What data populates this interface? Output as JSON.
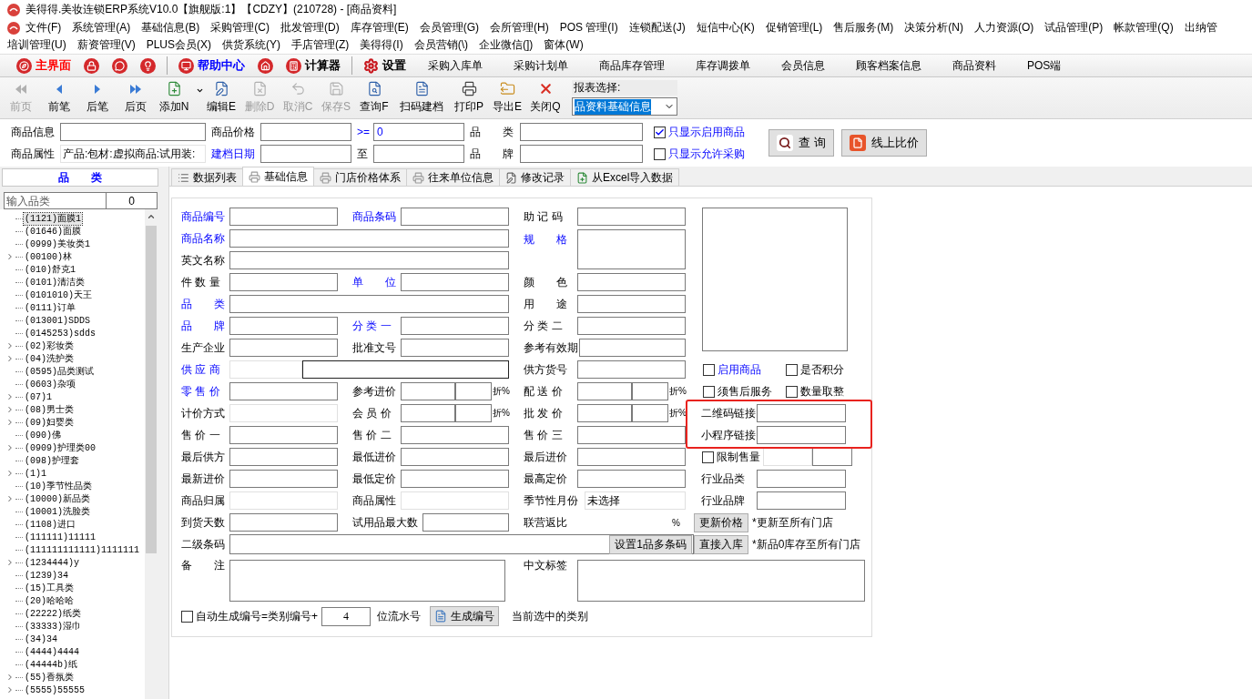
{
  "window": {
    "title": "美得得.美妆连锁ERP系统V10.0【旗舰版:1】【CDZY】(210728) - [商品资料]"
  },
  "menu_bar": {
    "rows": [
      [
        "文件(F)",
        "系统管理(A)",
        "基础信息(B)",
        "采购管理(C)",
        "批发管理(D)",
        "库存管理(E)",
        "会员管理(G)",
        "会所管理(H)",
        "POS 管理(I)",
        "连锁配送(J)",
        "短信中心(K)",
        "促销管理(L)",
        "售后服务(M)",
        "决策分析(N)",
        "人力资源(O)",
        "试品管理(P)",
        "帐款管理(Q)",
        "出纳管"
      ],
      [
        "培训管理(U)",
        "薪资管理(V)",
        "PLUS会员(X)",
        "供货系统(Y)",
        "手店管理(Z)",
        "美得得(I)",
        "会员营销(\\)",
        "企业微信(])",
        "窗体(W)"
      ]
    ]
  },
  "quick_bar": [
    {
      "kind": "compass",
      "label": "主界面",
      "color": "#ff0000"
    },
    {
      "kind": "lock"
    },
    {
      "kind": "chat"
    },
    {
      "kind": "bulb"
    },
    {
      "kind": "separator"
    },
    {
      "kind": "monitor",
      "label": "帮助中心",
      "color": "#0000ff"
    },
    {
      "kind": "home"
    },
    {
      "kind": "calculator",
      "label": "计算器"
    },
    {
      "kind": "separator"
    },
    {
      "kind": "gear",
      "label": "设置"
    }
  ],
  "shortcuts": [
    "采购入库单",
    "采购计划单",
    "商品库存管理",
    "库存调拨单",
    "会员信息",
    "顾客档案信息",
    "商品资料",
    "POS端"
  ],
  "toolbar": [
    {
      "kind": "first",
      "label": "前页",
      "disabled": true
    },
    {
      "kind": "prev",
      "label": "前笔",
      "disabled": false
    },
    {
      "kind": "next",
      "label": "后笔",
      "disabled": false
    },
    {
      "kind": "last",
      "label": "后页",
      "disabled": false
    },
    {
      "kind": "add",
      "label": "添加N",
      "disabled": false,
      "dropdown": true
    },
    {
      "kind": "edit",
      "label": "编辑E",
      "disabled": false
    },
    {
      "kind": "delete",
      "label": "删除D",
      "disabled": true
    },
    {
      "kind": "cancel",
      "label": "取消C",
      "disabled": true
    },
    {
      "kind": "save",
      "label": "保存S",
      "disabled": true
    },
    {
      "kind": "query",
      "label": "查询F",
      "disabled": false
    },
    {
      "kind": "scan",
      "label": "扫码建档",
      "disabled": false
    },
    {
      "kind": "print",
      "label": "打印P",
      "disabled": false
    },
    {
      "kind": "export",
      "label": "导出E",
      "disabled": false
    },
    {
      "kind": "close",
      "label": "关闭Q",
      "disabled": false
    }
  ],
  "report_select": {
    "label": "报表选择:",
    "value": "品资料基础信息"
  },
  "filter": {
    "product_info": {
      "label": "商品信息"
    },
    "price": {
      "label": "商品价格",
      "operator": ">=",
      "value": "0"
    },
    "category": {
      "label": "品　　类"
    },
    "only_enabled": {
      "label": "只显示启用商品",
      "checked": true
    },
    "attributes": {
      "label": "商品属性",
      "value": "产品:包材:虚拟商品:试用装:"
    },
    "created_date": {
      "label": "建档日期",
      "to_label": "至"
    },
    "brand": {
      "label": "品　　牌"
    },
    "only_purchasable": {
      "label": "只显示允许采购",
      "checked": false
    },
    "buttons": [
      {
        "kind": "search",
        "label": "查 询"
      },
      {
        "kind": "compare",
        "label": "线上比价"
      }
    ]
  },
  "category_panel": {
    "title": "品　　类",
    "search": {
      "placeholder": "输入品类"
    },
    "count": "0",
    "items": [
      {
        "label": "(1121)面膜1",
        "expandable": false,
        "selected": true
      },
      {
        "label": "(01646)面膜",
        "expandable": false,
        "selected": false
      },
      {
        "label": "(0999)美妆类1",
        "expandable": false,
        "selected": false
      },
      {
        "label": "(00100)林",
        "expandable": true,
        "selected": false
      },
      {
        "label": "(010)舒克1",
        "expandable": false,
        "selected": false
      },
      {
        "label": "(0101)清洁类",
        "expandable": false,
        "selected": false
      },
      {
        "label": "(0101010)天王",
        "expandable": false,
        "selected": false
      },
      {
        "label": "(0111)订单",
        "expandable": false,
        "selected": false
      },
      {
        "label": "(013001)SDDS",
        "expandable": false,
        "selected": false
      },
      {
        "label": "(0145253)sdds",
        "expandable": false,
        "selected": false
      },
      {
        "label": "(02)彩妆类",
        "expandable": true,
        "selected": false
      },
      {
        "label": "(04)洗护类",
        "expandable": true,
        "selected": false
      },
      {
        "label": "(0595)品类测试",
        "expandable": false,
        "selected": false
      },
      {
        "label": "(0603)杂项",
        "expandable": false,
        "selected": false
      },
      {
        "label": "(07)1",
        "expandable": true,
        "selected": false
      },
      {
        "label": "(08)男士类",
        "expandable": true,
        "selected": false
      },
      {
        "label": "(09)妇婴类",
        "expandable": true,
        "selected": false
      },
      {
        "label": "(090)佛",
        "expandable": false,
        "selected": false
      },
      {
        "label": "(0909)护理类00",
        "expandable": true,
        "selected": false
      },
      {
        "label": "(098)护理套",
        "expandable": false,
        "selected": false
      },
      {
        "label": "(1)1",
        "expandable": true,
        "selected": false
      },
      {
        "label": "(10)季节性品类",
        "expandable": false,
        "selected": false
      },
      {
        "label": "(10000)新品类",
        "expandable": true,
        "selected": false
      },
      {
        "label": "(10001)洗脸类",
        "expandable": false,
        "selected": false
      },
      {
        "label": "(1108)进口",
        "expandable": false,
        "selected": false
      },
      {
        "label": "(111111)11111",
        "expandable": false,
        "selected": false
      },
      {
        "label": "(111111111111)1111111",
        "expandable": false,
        "selected": false
      },
      {
        "label": "(1234444)y",
        "expandable": true,
        "selected": false
      },
      {
        "label": "(1239)34",
        "expandable": false,
        "selected": false
      },
      {
        "label": "(15)工具类",
        "expandable": false,
        "selected": false
      },
      {
        "label": "(20)哈哈哈",
        "expandable": false,
        "selected": false
      },
      {
        "label": "(22222)纸类",
        "expandable": false,
        "selected": false
      },
      {
        "label": "(33333)湿巾",
        "expandable": false,
        "selected": false
      },
      {
        "label": "(34)34",
        "expandable": false,
        "selected": false
      },
      {
        "label": "(4444)4444",
        "expandable": false,
        "selected": false
      },
      {
        "label": "(44444b)纸",
        "expandable": false,
        "selected": false
      },
      {
        "label": "(55)香氛类",
        "expandable": true,
        "selected": false
      },
      {
        "label": "(5555)55555",
        "expandable": true,
        "selected": false
      }
    ]
  },
  "tabs": [
    {
      "kind": "list",
      "label": "数据列表",
      "selected": false
    },
    {
      "kind": "printer",
      "label": "基础信息",
      "selected": true
    },
    {
      "kind": "printer",
      "label": "门店价格体系",
      "selected": false
    },
    {
      "kind": "printer",
      "label": "往来单位信息",
      "selected": false
    },
    {
      "kind": "edit",
      "label": "修改记录",
      "selected": false
    },
    {
      "kind": "excel",
      "label": "从Excel导入数据",
      "selected": false
    }
  ],
  "form": {
    "rows": [
      {
        "left": {
          "kind": "field",
          "label": "商品编号",
          "required": true
        },
        "middle": {
          "kind": "field",
          "label": "商品条码",
          "required": true
        },
        "right": {
          "kind": "field",
          "label": "助 记 码",
          "required": false
        },
        "side": {
          "kind": "image"
        }
      },
      {
        "left": {
          "kind": "wide",
          "label": "商品名称",
          "required": true
        },
        "right": {
          "kind": "textarea",
          "label": "规　　格",
          "required": true
        }
      },
      {
        "left": {
          "kind": "wide",
          "label": "英文名称",
          "required": false
        }
      },
      {
        "left": {
          "kind": "field",
          "label": "件 数 量",
          "required": false
        },
        "middle": {
          "kind": "field",
          "label": "单　　位",
          "required": true
        },
        "right": {
          "kind": "field",
          "label": "颜　　色",
          "required": false
        }
      },
      {
        "left": {
          "kind": "wide",
          "label": "品　　类",
          "required": true
        },
        "right": {
          "kind": "field",
          "label": "用　　途",
          "required": false
        }
      },
      {
        "left": {
          "kind": "field",
          "label": "品　　牌",
          "required": true
        },
        "middle": {
          "kind": "field",
          "label": "分 类 一",
          "required": true
        },
        "right": {
          "kind": "field",
          "label": "分 类 二",
          "required": false
        }
      },
      {
        "left": {
          "kind": "field",
          "label": "生产企业",
          "required": false
        },
        "middle": {
          "kind": "field",
          "label": "批准文号",
          "required": false
        },
        "right": {
          "kind": "field",
          "label": "参考有效期",
          "required": false
        }
      },
      {
        "left": {
          "kind": "split",
          "label": "供 应 商",
          "required": true
        },
        "right": {
          "kind": "field",
          "label": "供方货号",
          "required": false
        },
        "side": {
          "kind": "checks",
          "items": [
            {
              "label": "启用商品",
              "checked": false,
              "required": true
            },
            {
              "label": "是否积分",
              "checked": false,
              "required": false
            }
          ]
        }
      },
      {
        "left": {
          "kind": "field",
          "label": "零 售 价",
          "required": true
        },
        "middle": {
          "kind": "discount",
          "label": "参考进价",
          "suffix": "折%"
        },
        "right": {
          "kind": "discount",
          "label": "配 送 价",
          "suffix": "折%"
        },
        "side": {
          "kind": "checks",
          "items": [
            {
              "label": "须售后服务",
              "checked": false,
              "required": false
            },
            {
              "label": "数量取整",
              "checked": false,
              "required": false
            }
          ]
        }
      },
      {
        "left": {
          "kind": "readonly",
          "label": "计价方式"
        },
        "middle": {
          "kind": "discount",
          "label": "会 员 价",
          "suffix": "折%"
        },
        "right": {
          "kind": "discount",
          "label": "批 发 价",
          "suffix": "折%"
        },
        "side": {
          "kind": "field",
          "label": "二维码链接",
          "highlighted": true
        }
      },
      {
        "left": {
          "kind": "field",
          "label": "售 价 一",
          "required": false
        },
        "middle": {
          "kind": "field",
          "label": "售 价 二",
          "required": false
        },
        "right": {
          "kind": "field",
          "label": "售 价 三",
          "required": false
        },
        "side": {
          "kind": "field",
          "label": "小程序链接",
          "highlighted": true
        }
      },
      {
        "left": {
          "kind": "field",
          "label": "最后供方",
          "required": false
        },
        "middle": {
          "kind": "field",
          "label": "最低进价",
          "required": false
        },
        "right": {
          "kind": "field",
          "label": "最后进价",
          "required": false
        },
        "side": {
          "kind": "limit",
          "label": "限制售量",
          "checked": false
        }
      },
      {
        "left": {
          "kind": "field",
          "label": "最新进价",
          "required": false
        },
        "middle": {
          "kind": "field",
          "label": "最低定价",
          "required": false
        },
        "right": {
          "kind": "field",
          "label": "最高定价",
          "required": false
        },
        "side": {
          "kind": "field",
          "label": "行业品类"
        }
      },
      {
        "left": {
          "kind": "readonly",
          "label": "商品归属"
        },
        "middle": {
          "kind": "readonly",
          "label": "商品属性"
        },
        "right": {
          "kind": "readonly",
          "label": "季节性月份",
          "value": "未选择"
        },
        "side": {
          "kind": "field",
          "label": "行业品牌"
        }
      },
      {
        "left": {
          "kind": "field",
          "label": "到货天数",
          "required": false
        },
        "middle": {
          "kind": "field",
          "label": "试用品最大数",
          "required": false
        },
        "right": {
          "kind": "ratio",
          "label": "联营返比",
          "suffix": "%"
        },
        "side": {
          "kind": "action",
          "button": "更新价格",
          "note": "*更新至所有门店"
        }
      },
      {
        "left": {
          "kind": "barcode",
          "label": "二级条码",
          "button": "设置1品多条码"
        },
        "side": {
          "kind": "action",
          "button": "直接入库",
          "note": "*新品0库存至所有门店"
        }
      },
      {
        "left": {
          "kind": "memo",
          "label": "备　　注"
        },
        "right": {
          "kind": "memo",
          "label": "中文标签"
        }
      }
    ],
    "footer": {
      "checkbox": {
        "label": "自动生成编号=类别编号+",
        "checked": false
      },
      "digits": "4",
      "digits_label": "位流水号",
      "button": "生成编号",
      "note": "当前选中的类别"
    }
  }
}
